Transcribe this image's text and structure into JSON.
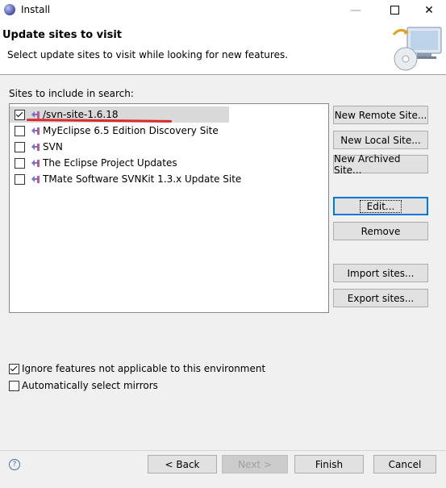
{
  "window": {
    "title": "Install",
    "minimize_glyph": "—",
    "maximize_glyph": "",
    "close_glyph": "✕"
  },
  "header": {
    "title": "Update sites to visit",
    "description": "Select update sites to visit while looking for new features."
  },
  "sites": {
    "label": "Sites to include in search:",
    "items": [
      {
        "name": "/svn-site-1.6.18",
        "checked": true,
        "selected": true
      },
      {
        "name": "MyEclipse 6.5 Edition Discovery Site",
        "checked": false
      },
      {
        "name": "SVN",
        "checked": false
      },
      {
        "name": "The Eclipse Project Updates",
        "checked": false
      },
      {
        "name": "TMate Software SVNKit 1.3.x Update Site",
        "checked": false
      }
    ]
  },
  "side_buttons": {
    "new_remote": "New Remote Site...",
    "new_local": "New Local Site...",
    "new_archived": "New Archived Site...",
    "edit": "Edit...",
    "remove": "Remove",
    "import": "Import sites...",
    "export": "Export sites..."
  },
  "options": {
    "ignore_features": {
      "label": "Ignore features not applicable to this environment",
      "checked": true
    },
    "auto_mirrors": {
      "label": "Automatically select mirrors",
      "checked": false
    }
  },
  "footer": {
    "help": "?",
    "back": "< Back",
    "next": "Next >",
    "finish": "Finish",
    "cancel": "Cancel"
  },
  "colors": {
    "highlight_underline": "#d92b2b",
    "default_button_border": "#0078d7"
  }
}
